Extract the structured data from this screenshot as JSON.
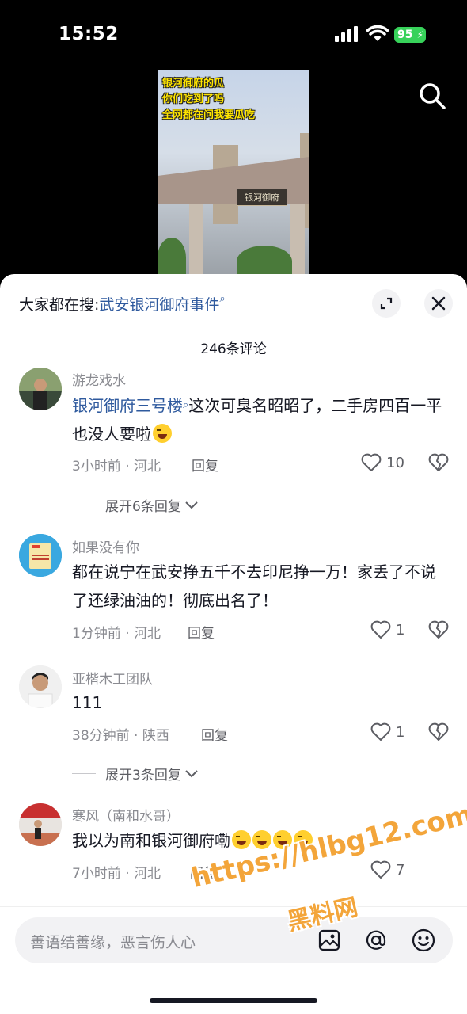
{
  "status": {
    "time": "15:52",
    "battery": "95"
  },
  "video": {
    "caption": [
      "银河御府的瓜",
      "你们吃到了吗",
      "全网都在问我要瓜吃"
    ],
    "sign": "银河御府"
  },
  "sheet": {
    "hot_prefix": "大家都在搜:",
    "hot_link": "武安银河御府事件",
    "comment_count": "246条评论"
  },
  "comments": [
    {
      "user": "游龙戏水",
      "link": "银河御府三号楼",
      "text": "这次可臭名昭昭了，二手房四百一平也没人要啦",
      "meta": "3小时前 · 河北",
      "reply": "回复",
      "likes": "10",
      "expand": "展开6条回复"
    },
    {
      "user": "如果没有你",
      "text": "都在说宁在武安挣五千不去印尼挣一万！家丢了不说了还绿油油的！彻底出名了！",
      "meta": "1分钟前 · 河北",
      "reply": "回复",
      "likes": "1"
    },
    {
      "user": "亚楷木工团队",
      "text": "111",
      "meta": "38分钟前 · 陕西",
      "reply": "回复",
      "likes": "1",
      "expand": "展开3条回复"
    },
    {
      "user": "寒风（南和水哥）",
      "text": "我以为南和银河御府嘞",
      "meta": "7小时前 · 河北",
      "reply": "回复",
      "likes": "7"
    }
  ],
  "input": {
    "placeholder": "善语结善缘，恶言伤人心"
  },
  "watermark": {
    "line1": "https://hlbg12.com",
    "line2": "黑料网"
  },
  "colors": {
    "link": "#2f5a9e",
    "battery": "#37d25a",
    "watermark": "#f3a53a"
  }
}
